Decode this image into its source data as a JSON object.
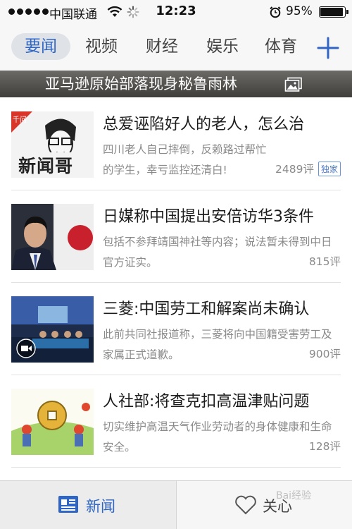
{
  "status_bar": {
    "carrier": "中国联通",
    "time": "12:23",
    "battery_percent": "95%",
    "battery_level": 0.95,
    "icons": [
      "signal-dots-icon",
      "wifi-icon",
      "activity-spinner-icon",
      "alarm-icon",
      "battery-icon"
    ]
  },
  "tabs": {
    "items": [
      {
        "label": "要闻",
        "active": true
      },
      {
        "label": "视频",
        "active": false
      },
      {
        "label": "财经",
        "active": false
      },
      {
        "label": "娱乐",
        "active": false
      },
      {
        "label": "体育",
        "active": false
      }
    ],
    "add_icon": "plus-icon"
  },
  "banner": {
    "title": "亚马逊原始部落现身秘鲁雨林",
    "icon": "gallery-icon"
  },
  "news": [
    {
      "headline": "总爱诬陷好人的老人，怎么治",
      "summary": "四川老人自己摔倒，反赖路过帮忙的学生，幸亏监控还清白!",
      "comments": "2489评",
      "tag": "独家",
      "thumb_text": "新闻哥",
      "thumb_badge": "千问"
    },
    {
      "headline": "日媒称中国提出安倍访华3条件",
      "summary": "包括不参拜靖国神社等内容；说法暂未得到中日官方证实。",
      "comments": "815评",
      "tag": ""
    },
    {
      "headline": "三菱:中国劳工和解案尚未确认",
      "summary": "此前共同社报道称，三菱将向中国籍受害劳工及家属正式道歉。",
      "comments": "900评",
      "tag": ""
    },
    {
      "headline": "人社部:将查克扣高温津贴问题",
      "summary": "切实维护高温天气作业劳动者的身体健康和生命安全。",
      "comments": "128评",
      "tag": ""
    }
  ],
  "bottom_bar": {
    "news_label": "新闻",
    "follow_label": "关心",
    "news_icon": "news-icon",
    "follow_icon": "heart-icon"
  },
  "watermark": "Bai经验"
}
